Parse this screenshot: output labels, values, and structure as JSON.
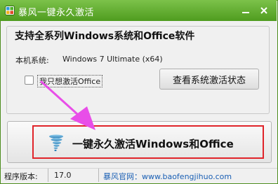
{
  "window": {
    "title": "暴风一键永久激活",
    "minimize_symbol": "—",
    "close_symbol": "✕"
  },
  "group": {
    "title": "支持全系列Windows系统和Office软件",
    "system_label": "本机系统:",
    "system_value": "Windows 7 Ultimate (x64)",
    "checkbox_label": "我只想激活Office",
    "checkbox_checked": false,
    "status_button_label": "查看系统激活状态"
  },
  "main_button": {
    "label": "一键永久激活Windows和Office",
    "icon": "tornado-icon"
  },
  "statusbar": {
    "version_label": "程序版本:",
    "version_value": "17.0",
    "site_text": "暴风官网：www.baofengjihuo.com"
  },
  "colors": {
    "titlebar": "#5aa52a",
    "highlight_border": "#e0242a",
    "arrow": "#e84ee8",
    "link": "#1a5fb4"
  }
}
